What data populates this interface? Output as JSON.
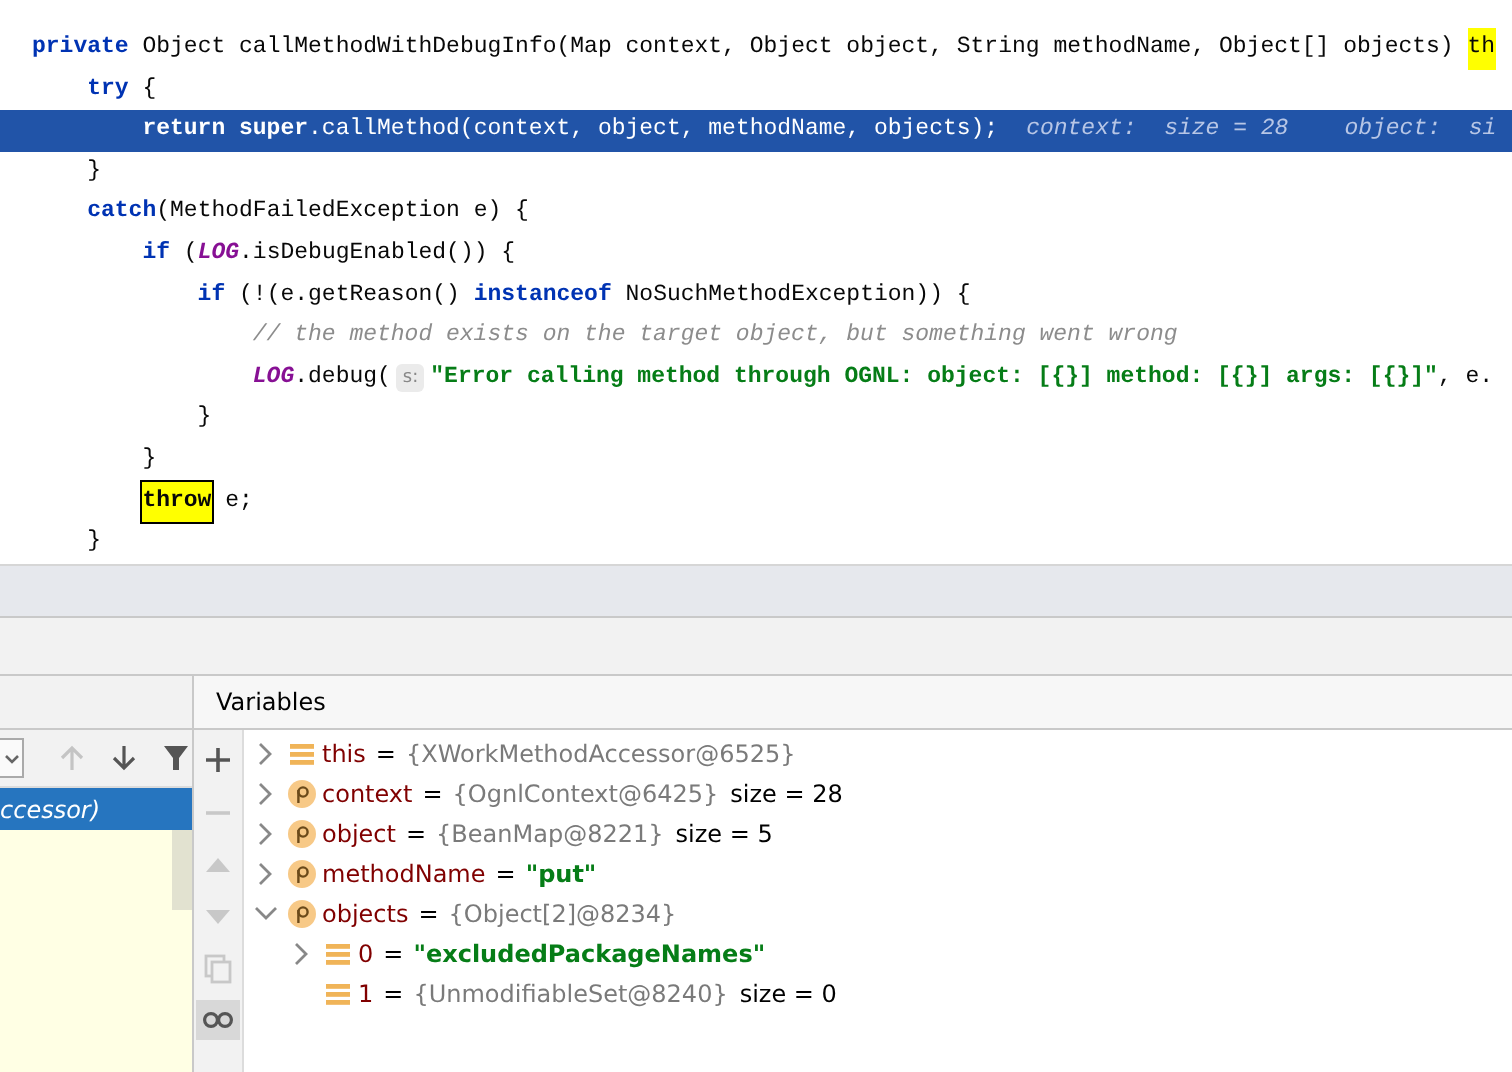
{
  "editor": {
    "lines": [
      {
        "selected": false,
        "tokens": [
          {
            "kind": "kw",
            "text": "private"
          },
          {
            "kind": "plain",
            "text": " Object callMethodWithDebugInfo(Map context, Object object, String methodName, Object[] objects) "
          },
          {
            "kind": "mark",
            "text": "th"
          }
        ],
        "children": [
          {
            "selected": false,
            "tokens": [
              {
                "kind": "kw",
                "text": "try"
              },
              {
                "kind": "plain",
                "text": " {"
              }
            ],
            "children": [
              {
                "selected": true,
                "tokens": [
                  {
                    "kind": "kw",
                    "text": "return super"
                  },
                  {
                    "kind": "plain",
                    "text": ".callMethod(context, object, methodName, objects);"
                  },
                  {
                    "kind": "hint",
                    "text": "context:  size = 28"
                  },
                  {
                    "kind": "hint",
                    "text": "object:  si"
                  }
                ]
              }
            ]
          },
          {
            "selected": false,
            "tokens": [
              {
                "kind": "plain",
                "text": "}"
              }
            ]
          },
          {
            "selected": false,
            "tokens": [
              {
                "kind": "kw",
                "text": "catch"
              },
              {
                "kind": "plain",
                "text": "(MethodFailedException e) {"
              }
            ],
            "children": [
              {
                "selected": false,
                "tokens": [
                  {
                    "kind": "kw",
                    "text": "if"
                  },
                  {
                    "kind": "plain",
                    "text": " ("
                  },
                  {
                    "kind": "field",
                    "text": "LOG"
                  },
                  {
                    "kind": "plain",
                    "text": ".isDebugEnabled()) {"
                  }
                ],
                "children": [
                  {
                    "selected": false,
                    "tokens": [
                      {
                        "kind": "kw",
                        "text": "if"
                      },
                      {
                        "kind": "plain",
                        "text": " (!(e.getReason() "
                      },
                      {
                        "kind": "kw",
                        "text": "instanceof"
                      },
                      {
                        "kind": "plain",
                        "text": " NoSuchMethodException)) {"
                      }
                    ],
                    "children": [
                      {
                        "selected": false,
                        "tokens": [
                          {
                            "kind": "comment",
                            "text": "// the method exists on the target object, but something went wrong"
                          }
                        ]
                      },
                      {
                        "selected": false,
                        "tokens": [
                          {
                            "kind": "field",
                            "text": "LOG"
                          },
                          {
                            "kind": "plain",
                            "text": ".debug("
                          },
                          {
                            "kind": "inlay",
                            "text": "s:"
                          },
                          {
                            "kind": "string",
                            "text": "\"Error calling method through OGNL: object: [{}] method: [{}] args: [{}]\""
                          },
                          {
                            "kind": "plain",
                            "text": ", e."
                          }
                        ]
                      }
                    ]
                  },
                  {
                    "selected": false,
                    "tokens": [
                      {
                        "kind": "plain",
                        "text": "}"
                      }
                    ]
                  }
                ]
              },
              {
                "selected": false,
                "tokens": [
                  {
                    "kind": "plain",
                    "text": "}"
                  }
                ]
              },
              {
                "selected": false,
                "tokens": [
                  {
                    "kind": "hit",
                    "text": "throw"
                  },
                  {
                    "kind": "plain",
                    "text": " e;"
                  }
                ]
              }
            ]
          },
          {
            "selected": false,
            "tokens": [
              {
                "kind": "plain",
                "text": "}"
              }
            ]
          }
        ]
      }
    ]
  },
  "frames": {
    "toolbar": [
      {
        "kind": "dropdown",
        "disabled": false
      },
      {
        "kind": "up",
        "disabled": true
      },
      {
        "kind": "down",
        "disabled": false
      },
      {
        "kind": "filter",
        "disabled": false
      }
    ],
    "items": [
      {
        "label": "ccessor)",
        "selected": true
      }
    ]
  },
  "variables": {
    "title": "Variables",
    "tools": [
      {
        "kind": "plus",
        "disabled": false,
        "on": false
      },
      {
        "kind": "minus",
        "disabled": true,
        "on": false
      },
      {
        "kind": "up",
        "disabled": true,
        "on": false
      },
      {
        "kind": "down",
        "disabled": true,
        "on": false
      },
      {
        "kind": "copy",
        "disabled": true,
        "on": false
      },
      {
        "kind": "glasses",
        "disabled": false,
        "on": true
      }
    ],
    "items": [
      {
        "kind": "field",
        "expanded": false,
        "name": "this",
        "operator": "=",
        "value": {
          "kind": "ref",
          "text": "{XWorkMethodAccessor@6525}"
        }
      },
      {
        "kind": "param",
        "expanded": false,
        "name": "context",
        "operator": "=",
        "value": {
          "kind": "ref",
          "text": "{OgnlContext@6425}"
        },
        "extra": "size = 28"
      },
      {
        "kind": "param",
        "expanded": false,
        "name": "object",
        "operator": "=",
        "value": {
          "kind": "ref",
          "text": "{BeanMap@8221}"
        },
        "extra": "size = 5"
      },
      {
        "kind": "param",
        "expanded": false,
        "name": "methodName",
        "operator": "=",
        "value": {
          "kind": "string",
          "text": "\"put\""
        }
      },
      {
        "kind": "param",
        "expanded": true,
        "name": "objects",
        "operator": "=",
        "value": {
          "kind": "ref",
          "text": "{Object[2]@8234}"
        },
        "children": [
          {
            "kind": "field",
            "expanded": false,
            "name": "0",
            "operator": "=",
            "value": {
              "kind": "string",
              "text": "\"excludedPackageNames\""
            }
          },
          {
            "kind": "field",
            "name": "1",
            "operator": "=",
            "value": {
              "kind": "ref",
              "text": "{UnmodifiableSet@8240}"
            },
            "extra": "size = 0"
          }
        ]
      }
    ]
  }
}
